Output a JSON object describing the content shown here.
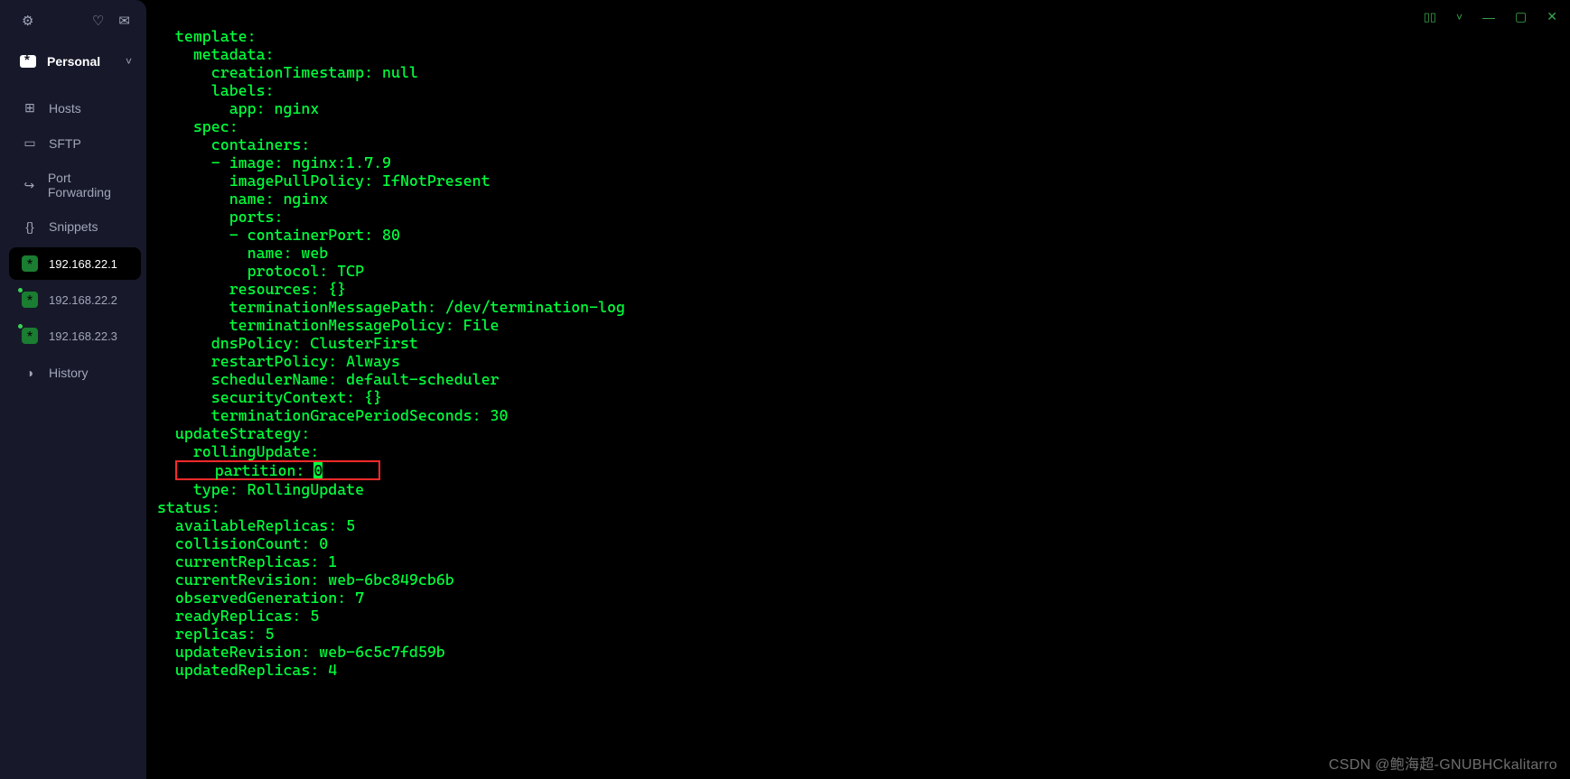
{
  "window_controls": {
    "panel": "▯▯",
    "dropdown": "˅",
    "minimize": "—",
    "maximize": "▢",
    "close": "✕"
  },
  "sidebar": {
    "workspace": {
      "label": "Personal"
    },
    "nav": [
      {
        "id": "hosts",
        "label": "Hosts",
        "icon": "⊞"
      },
      {
        "id": "sftp",
        "label": "SFTP",
        "icon": "▭"
      },
      {
        "id": "port-forwarding",
        "label": "Port Forwarding",
        "icon": "↪"
      },
      {
        "id": "snippets",
        "label": "Snippets",
        "icon": "{}"
      }
    ],
    "connections": [
      {
        "id": "c1",
        "label": "192.168.22.1",
        "active": true,
        "connected": false
      },
      {
        "id": "c2",
        "label": "192.168.22.2",
        "active": false,
        "connected": true
      },
      {
        "id": "c3",
        "label": "192.168.22.3",
        "active": false,
        "connected": true
      }
    ],
    "history": {
      "label": "History",
      "icon": "◑"
    }
  },
  "terminal": {
    "lines": [
      {
        "indent": 2,
        "text": "template:"
      },
      {
        "indent": 4,
        "text": "metadata:"
      },
      {
        "indent": 6,
        "text": "creationTimestamp: null"
      },
      {
        "indent": 6,
        "text": "labels:"
      },
      {
        "indent": 8,
        "text": "app: nginx"
      },
      {
        "indent": 4,
        "text": "spec:"
      },
      {
        "indent": 6,
        "text": "containers:"
      },
      {
        "indent": 6,
        "text": "- image: nginx:1.7.9"
      },
      {
        "indent": 8,
        "text": "imagePullPolicy: IfNotPresent"
      },
      {
        "indent": 8,
        "text": "name: nginx"
      },
      {
        "indent": 8,
        "text": "ports:"
      },
      {
        "indent": 8,
        "text": "- containerPort: 80"
      },
      {
        "indent": 10,
        "text": "name: web"
      },
      {
        "indent": 10,
        "text": "protocol: TCP"
      },
      {
        "indent": 8,
        "text": "resources: {}"
      },
      {
        "indent": 8,
        "text": "terminationMessagePath: /dev/termination-log"
      },
      {
        "indent": 8,
        "text": "terminationMessagePolicy: File"
      },
      {
        "indent": 6,
        "text": "dnsPolicy: ClusterFirst"
      },
      {
        "indent": 6,
        "text": "restartPolicy: Always"
      },
      {
        "indent": 6,
        "text": "schedulerName: default-scheduler"
      },
      {
        "indent": 6,
        "text": "securityContext: {}"
      },
      {
        "indent": 6,
        "text": "terminationGracePeriodSeconds: 30"
      },
      {
        "indent": 2,
        "text": "updateStrategy:"
      },
      {
        "indent": 4,
        "text": "rollingUpdate:"
      },
      {
        "indent": 6,
        "text": "partition: ",
        "highlight": true,
        "cursor_char": "0"
      },
      {
        "indent": 4,
        "text": "type: RollingUpdate"
      },
      {
        "indent": 0,
        "text": "status:"
      },
      {
        "indent": 2,
        "text": "availableReplicas: 5"
      },
      {
        "indent": 2,
        "text": "collisionCount: 0"
      },
      {
        "indent": 2,
        "text": "currentReplicas: 1"
      },
      {
        "indent": 2,
        "text": "currentRevision: web-6bc849cb6b"
      },
      {
        "indent": 2,
        "text": "observedGeneration: 7"
      },
      {
        "indent": 2,
        "text": "readyReplicas: 5"
      },
      {
        "indent": 2,
        "text": "replicas: 5"
      },
      {
        "indent": 2,
        "text": "updateRevision: web-6c5c7fd59b"
      },
      {
        "indent": 2,
        "text": "updatedReplicas: 4"
      }
    ]
  },
  "watermark": "CSDN @鲍海超-GNUBHCkalitarro"
}
